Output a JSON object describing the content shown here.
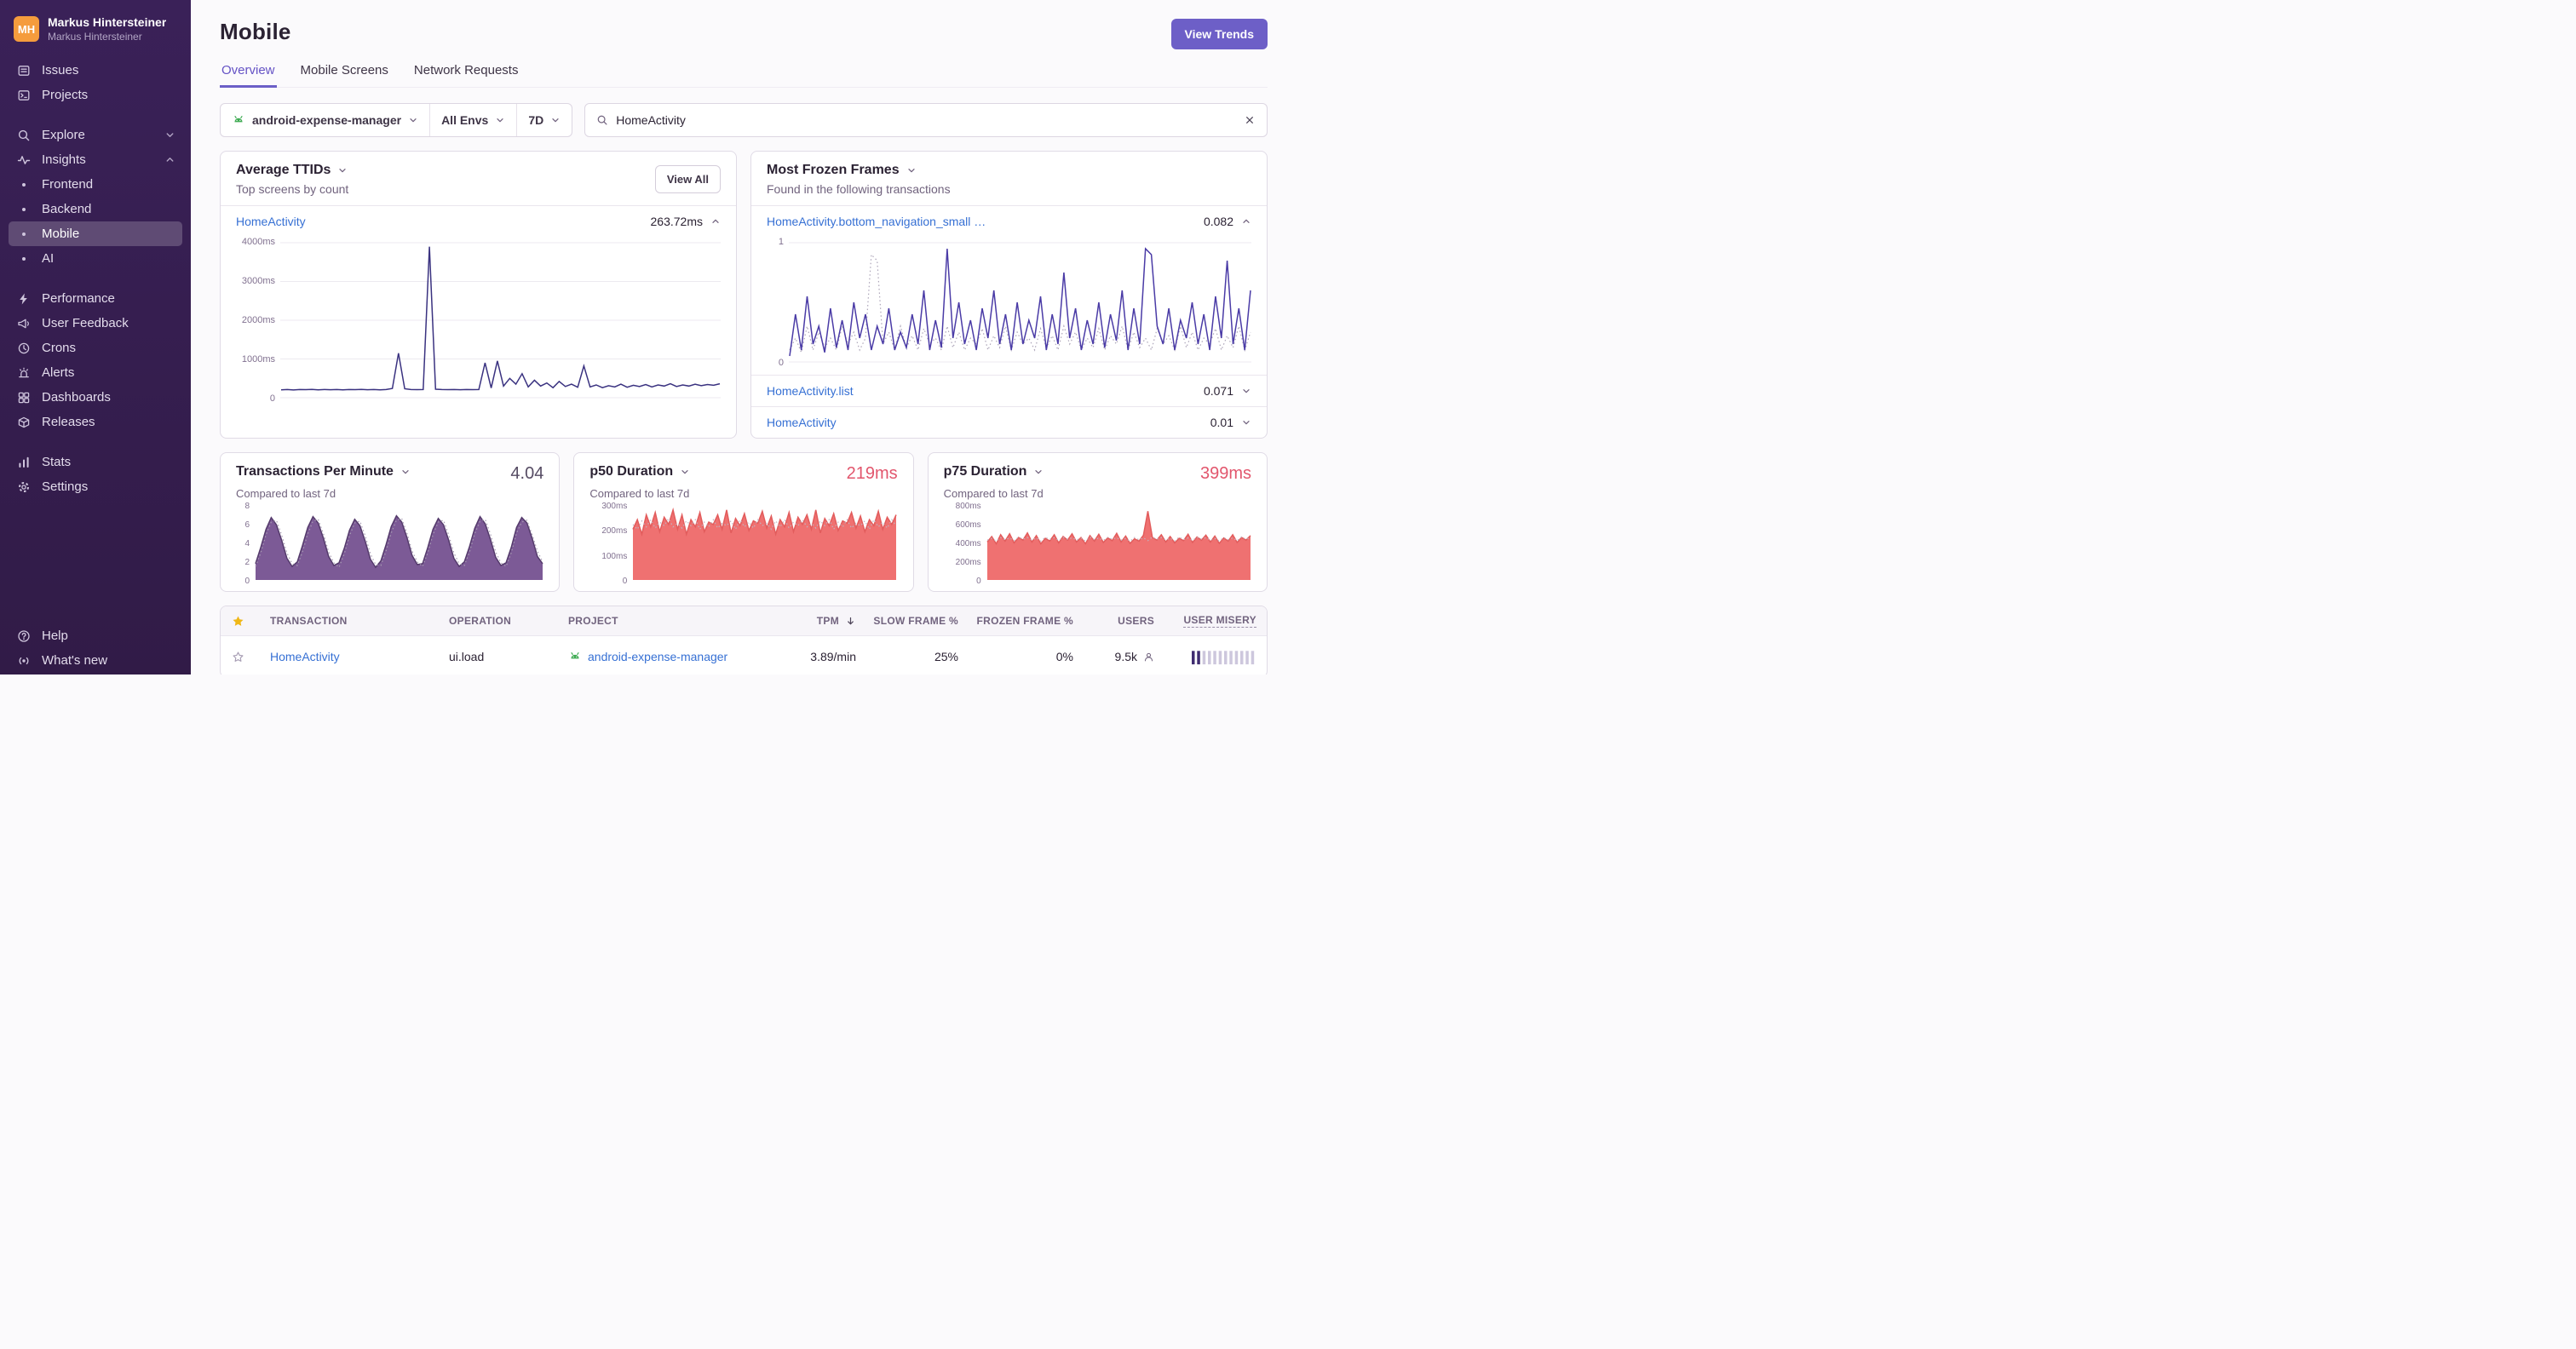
{
  "theme": {
    "accent_purple": "#6d5fc7",
    "link_blue": "#3670d4",
    "danger_red": "#e2566d",
    "android_green": "#3fab53",
    "star_yellow": "#efb717"
  },
  "sidebar": {
    "user_initials": "MH",
    "user_name": "Markus Hintersteiner",
    "user_org": "Markus Hintersteiner",
    "issues": "Issues",
    "projects": "Projects",
    "explore": "Explore",
    "insights": "Insights",
    "frontend": "Frontend",
    "backend": "Backend",
    "mobile": "Mobile",
    "ai": "AI",
    "performance": "Performance",
    "user_feedback": "User Feedback",
    "crons": "Crons",
    "alerts": "Alerts",
    "dashboards": "Dashboards",
    "releases": "Releases",
    "stats": "Stats",
    "settings": "Settings",
    "help": "Help",
    "whats_new": "What's new"
  },
  "page": {
    "title": "Mobile",
    "view_trends": "View Trends"
  },
  "tabs": {
    "overview": "Overview",
    "mobile_screens": "Mobile Screens",
    "network_requests": "Network Requests"
  },
  "filters": {
    "project": "android-expense-manager",
    "environment": "All Envs",
    "period": "7D",
    "search_value": "HomeActivity"
  },
  "ttid": {
    "title": "Average TTIDs",
    "subtitle": "Top screens by count",
    "view_all": "View All",
    "row_name": "HomeActivity",
    "row_value": "263.72ms"
  },
  "frozen": {
    "title": "Most Frozen Frames",
    "subtitle": "Found in the following transactions",
    "rows": [
      {
        "name": "HomeActivity.bottom_navigation_small …",
        "value": "0.082"
      },
      {
        "name": "HomeActivity.list",
        "value": "0.071"
      },
      {
        "name": "HomeActivity",
        "value": "0.01"
      }
    ]
  },
  "metrics": [
    {
      "title": "Transactions Per Minute",
      "value": "4.04",
      "subtitle": "Compared to last 7d"
    },
    {
      "title": "p50 Duration",
      "value": "219ms",
      "subtitle": "Compared to last 7d"
    },
    {
      "title": "p75 Duration",
      "value": "399ms",
      "subtitle": "Compared to last 7d"
    }
  ],
  "table": {
    "headers": {
      "transaction": "TRANSACTION",
      "operation": "OPERATION",
      "project": "PROJECT",
      "tpm": "TPM",
      "slow_frame": "SLOW FRAME %",
      "frozen_frame": "FROZEN FRAME %",
      "users": "USERS",
      "user_misery": "USER MISERY"
    },
    "rows": [
      {
        "transaction": "HomeActivity",
        "operation": "ui.load",
        "project": "android-expense-manager",
        "tpm": "3.89/min",
        "slow_frame_pct": "25%",
        "frozen_frame_pct": "0%",
        "users": "9.5k"
      }
    ]
  },
  "chart_data": [
    {
      "label": "Average TTID — HomeActivity",
      "type": "line",
      "ymin": 0,
      "ymax": 4000,
      "gridlines": 5,
      "y_ticks": [
        "4000ms",
        "3000ms",
        "2000ms",
        "1000ms",
        "0"
      ],
      "color_line": "#3a3280",
      "values": [
        205,
        210,
        200,
        212,
        208,
        215,
        205,
        210,
        206,
        212,
        204,
        210,
        208,
        214,
        206,
        210,
        205,
        212,
        240,
        1150,
        230,
        210,
        208,
        212,
        3900,
        220,
        210,
        208,
        212,
        206,
        210,
        208,
        212,
        900,
        250,
        950,
        300,
        500,
        350,
        620,
        280,
        450,
        300,
        380,
        260,
        420,
        290,
        350,
        270,
        820,
        280,
        330,
        260,
        310,
        280,
        350,
        270,
        320,
        290,
        340,
        280,
        330,
        300,
        360,
        290,
        330,
        300,
        350,
        310,
        340,
        320,
        360
      ]
    },
    {
      "label": "Frozen frames — HomeActivity.bottom_navigation_small",
      "type": "line",
      "ymin": 0,
      "ymax": 1,
      "gridlines": 2,
      "y_ticks": [
        "1",
        "0"
      ],
      "color_line": "#4a3ba6",
      "dash_color": "#aca4b8",
      "values": [
        0.05,
        0.4,
        0.1,
        0.55,
        0.15,
        0.3,
        0.08,
        0.45,
        0.12,
        0.35,
        0.1,
        0.5,
        0.2,
        0.4,
        0.1,
        0.3,
        0.15,
        0.45,
        0.1,
        0.25,
        0.12,
        0.4,
        0.15,
        0.6,
        0.1,
        0.35,
        0.12,
        0.95,
        0.2,
        0.5,
        0.15,
        0.35,
        0.1,
        0.45,
        0.2,
        0.6,
        0.15,
        0.4,
        0.1,
        0.5,
        0.15,
        0.35,
        0.2,
        0.55,
        0.1,
        0.4,
        0.15,
        0.75,
        0.2,
        0.45,
        0.1,
        0.35,
        0.15,
        0.5,
        0.12,
        0.4,
        0.18,
        0.6,
        0.1,
        0.45,
        0.15,
        0.95,
        0.9,
        0.3,
        0.15,
        0.45,
        0.1,
        0.35,
        0.2,
        0.5,
        0.15,
        0.4,
        0.1,
        0.55,
        0.2,
        0.85,
        0.15,
        0.45,
        0.1,
        0.6
      ],
      "values_prev": [
        0.1,
        0.2,
        0.08,
        0.3,
        0.1,
        0.25,
        0.12,
        0.2,
        0.1,
        0.3,
        0.15,
        0.25,
        0.1,
        0.2,
        0.9,
        0.85,
        0.15,
        0.25,
        0.1,
        0.3,
        0.12,
        0.22,
        0.1,
        0.28,
        0.15,
        0.2,
        0.1,
        0.3,
        0.12,
        0.25,
        0.1,
        0.2,
        0.15,
        0.28,
        0.1,
        0.22,
        0.12,
        0.3,
        0.1,
        0.25,
        0.15,
        0.2,
        0.1,
        0.28,
        0.12,
        0.22,
        0.1,
        0.3,
        0.15,
        0.25,
        0.1,
        0.2,
        0.12,
        0.28,
        0.1,
        0.22,
        0.15,
        0.3,
        0.1,
        0.25,
        0.12,
        0.2,
        0.1,
        0.28,
        0.15,
        0.22,
        0.1,
        0.3,
        0.12,
        0.25,
        0.1,
        0.2,
        0.15,
        0.28,
        0.1,
        0.22,
        0.12,
        0.3,
        0.1,
        0.25
      ]
    },
    {
      "label": "Transactions per minute (7d)",
      "type": "area",
      "ymin": 0,
      "ymax": 8,
      "gridlines": 0,
      "y_ticks": [
        "8",
        "6",
        "4",
        "2",
        "0"
      ],
      "color_line": "#543a6b",
      "color_fill": "#7c5a96",
      "dash_color": "#a79cb2",
      "values": [
        1.8,
        3.6,
        5.6,
        6.9,
        6.1,
        4.4,
        2.4,
        1.5,
        2.0,
        3.8,
        5.8,
        7.0,
        6.3,
        4.6,
        2.6,
        1.6,
        1.9,
        3.5,
        5.5,
        6.7,
        6.0,
        4.3,
        2.3,
        1.4,
        2.1,
        3.9,
        5.9,
        7.1,
        6.4,
        4.7,
        2.7,
        1.7,
        1.8,
        3.6,
        5.6,
        6.8,
        6.1,
        4.4,
        2.4,
        1.5,
        2.0,
        3.7,
        5.7,
        7.0,
        6.2,
        4.5,
        2.5,
        1.6,
        1.9,
        3.6,
        5.8,
        6.9,
        6.3,
        4.6,
        2.6,
        1.8
      ],
      "values_prev": [
        1.5,
        3.0,
        5.0,
        6.4,
        6.6,
        5.0,
        3.0,
        1.8,
        1.6,
        3.1,
        5.1,
        6.5,
        6.7,
        5.1,
        3.1,
        1.9,
        1.4,
        2.9,
        4.9,
        6.3,
        6.5,
        4.9,
        2.9,
        1.7,
        1.6,
        3.2,
        5.2,
        6.6,
        6.8,
        5.2,
        3.2,
        2.0,
        1.5,
        3.0,
        5.0,
        6.4,
        6.6,
        5.0,
        3.0,
        1.8,
        1.6,
        3.1,
        5.1,
        6.5,
        6.7,
        5.1,
        3.1,
        1.9,
        1.5,
        3.0,
        5.2,
        6.4,
        6.6,
        5.0,
        3.2,
        2.0
      ]
    },
    {
      "label": "p50 duration (ms)",
      "type": "area",
      "ymin": 0,
      "ymax": 300,
      "gridlines": 0,
      "y_ticks": [
        "300ms",
        "200ms",
        "100ms",
        "0"
      ],
      "color_line": "#e25c5c",
      "color_fill": "#ef7171",
      "dash_color": "#c0b4c1",
      "values": [
        210,
        250,
        190,
        270,
        220,
        280,
        200,
        260,
        230,
        290,
        210,
        270,
        190,
        250,
        220,
        280,
        200,
        240,
        230,
        270,
        210,
        290,
        195,
        255,
        225,
        275,
        205,
        245,
        235,
        285,
        215,
        265,
        190,
        250,
        220,
        280,
        200,
        260,
        230,
        270,
        210,
        290,
        195,
        255,
        225,
        275,
        205,
        245,
        235,
        280,
        215,
        265,
        200,
        250,
        225,
        285,
        210,
        260,
        230,
        270
      ],
      "values_prev": [
        230,
        210,
        245,
        220,
        250,
        215,
        240,
        225,
        255,
        220,
        235,
        215,
        245,
        225,
        250,
        210,
        240,
        220,
        250,
        215,
        235,
        225,
        245,
        210,
        250,
        220,
        240,
        215,
        250,
        225,
        235,
        210,
        245,
        220,
        250,
        215,
        240,
        225,
        250,
        220,
        235,
        215,
        245,
        225,
        250,
        210,
        240,
        220,
        250,
        215,
        235,
        225,
        245,
        210,
        250,
        220,
        240,
        215,
        250,
        225
      ]
    },
    {
      "label": "p75 duration (ms)",
      "type": "area",
      "ymin": 0,
      "ymax": 800,
      "gridlines": 0,
      "y_ticks": [
        "800ms",
        "600ms",
        "400ms",
        "200ms",
        "0"
      ],
      "color_line": "#e25c5c",
      "color_fill": "#ef7171",
      "dash_color": "#c0b4c1",
      "values": [
        420,
        480,
        400,
        500,
        430,
        510,
        410,
        470,
        440,
        520,
        420,
        490,
        400,
        460,
        430,
        500,
        410,
        480,
        440,
        510,
        420,
        470,
        400,
        490,
        430,
        505,
        415,
        465,
        435,
        515,
        420,
        485,
        405,
        455,
        430,
        495,
        760,
        470,
        440,
        500,
        420,
        480,
        410,
        460,
        435,
        505,
        415,
        475,
        440,
        495,
        420,
        485,
        405,
        465,
        430,
        500,
        415,
        470,
        440,
        490
      ],
      "values_prev": [
        440,
        460,
        430,
        470,
        445,
        465,
        435,
        475,
        450,
        470,
        440,
        465,
        430,
        472,
        448,
        468,
        436,
        470,
        450,
        466,
        442,
        462,
        432,
        474,
        446,
        464,
        438,
        472,
        452,
        468,
        440,
        460,
        430,
        470,
        445,
        465,
        435,
        475,
        450,
        470,
        442,
        462,
        432,
        474,
        446,
        464,
        438,
        472,
        452,
        468,
        440,
        460,
        430,
        470,
        445,
        465,
        435,
        475,
        450,
        466
      ]
    },
    {
      "label": "User misery score distribution",
      "type": "bar",
      "ymin": 0,
      "ymax": 8,
      "color": "#cdc7dd",
      "dark_color": "#3f2c70",
      "dark_count": 2,
      "values": [
        7,
        7,
        7,
        7,
        7,
        7,
        7,
        7,
        7,
        7,
        7,
        7
      ]
    }
  ]
}
